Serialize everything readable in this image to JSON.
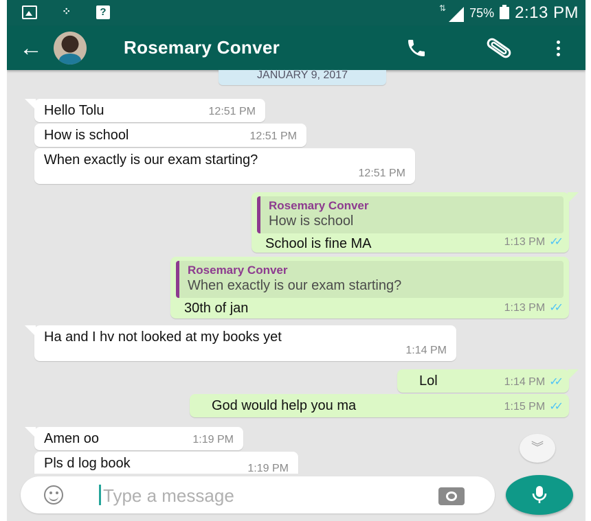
{
  "status_bar": {
    "battery_pct": "75%",
    "time": "2:13 PM",
    "icons": [
      "image-icon",
      "bbm-icon",
      "question-icon",
      "signal-icon",
      "battery-icon"
    ]
  },
  "header": {
    "contact_name": "Rosemary Conver",
    "icons": [
      "back-arrow-icon",
      "avatar",
      "call-icon",
      "paperclip-icon",
      "more-vert-icon"
    ]
  },
  "chat": {
    "date": "JANUARY 9, 2017",
    "messages": [
      {
        "dir": "in",
        "text": "Hello Tolu",
        "time": "12:51 PM"
      },
      {
        "dir": "in",
        "text": "How is school",
        "time": "12:51 PM"
      },
      {
        "dir": "in",
        "text": "When exactly is our exam starting?",
        "time": "12:51 PM"
      },
      {
        "dir": "out",
        "quote_name": "Rosemary Conver",
        "quote_text": "How is school",
        "text": "School is fine MA",
        "time": "1:13 PM",
        "read": true
      },
      {
        "dir": "out",
        "quote_name": "Rosemary Conver",
        "quote_text": "When exactly is our exam starting?",
        "text": "30th of jan",
        "time": "1:13 PM",
        "read": true
      },
      {
        "dir": "in",
        "text": "Ha and I hv not looked at my books yet",
        "time": "1:14 PM"
      },
      {
        "dir": "out",
        "text": "Lol",
        "time": "1:14 PM",
        "read": true
      },
      {
        "dir": "out",
        "text": "God would help you ma",
        "time": "1:15 PM",
        "read": true
      },
      {
        "dir": "in",
        "text": "Amen oo",
        "time": "1:19 PM"
      },
      {
        "dir": "in",
        "text": "Pls d log book",
        "time": "1:19 PM"
      }
    ],
    "tick_glyph": "✓✓",
    "scroll_glyph": "︾"
  },
  "input": {
    "placeholder": "Type a message"
  },
  "colors": {
    "header": "#075e54",
    "status_bar": "#0b5e55",
    "incoming_bubble": "#ffffff",
    "outgoing_bubble": "#dcf8c6",
    "quote_accent": "#8d3b8f",
    "read_ticks": "#4fc3f7",
    "mic_button": "#0f9988"
  }
}
